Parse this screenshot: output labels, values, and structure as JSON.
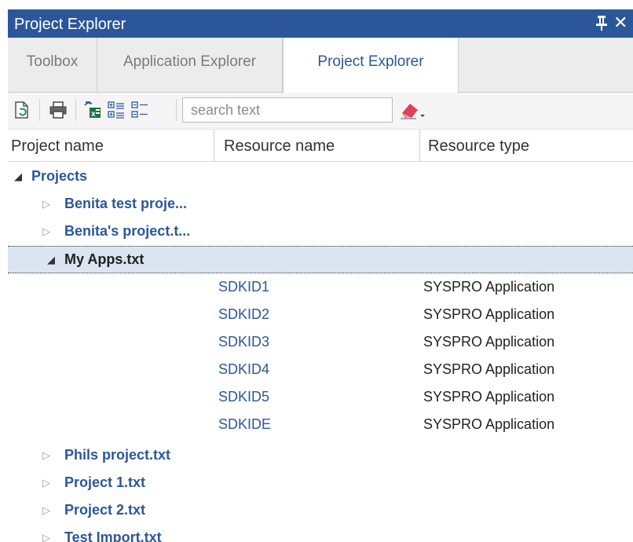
{
  "panel": {
    "title": "Project Explorer",
    "pin_icon": "pin-icon",
    "close_glyph": "✕"
  },
  "tabs": [
    {
      "label": "Toolbox",
      "active": false
    },
    {
      "label": "Application Explorer",
      "active": false
    },
    {
      "label": "Project Explorer",
      "active": true
    }
  ],
  "toolbar": {
    "icons": [
      "refresh-document-icon",
      "print-icon",
      "export-excel-icon",
      "expand-all-icon",
      "collapse-all-icon",
      "eraser-icon"
    ],
    "search_placeholder": "search text"
  },
  "columns": {
    "project_name": "Project name",
    "resource_name": "Resource name",
    "resource_type": "Resource type"
  },
  "tree": {
    "root": {
      "label": "Projects",
      "expanded": true
    },
    "items": [
      {
        "label": "Benita test proje...",
        "expanded": false
      },
      {
        "label": "Benita's project.t...",
        "expanded": false
      },
      {
        "label": "My Apps.txt",
        "expanded": true,
        "selected": true
      },
      {
        "label": "Phils project.txt",
        "expanded": false
      },
      {
        "label": "Project 1.txt",
        "expanded": false
      },
      {
        "label": "Project 2.txt",
        "expanded": false
      },
      {
        "label": "Test Import.txt",
        "expanded": false
      }
    ],
    "resources": [
      {
        "name": "SDKID1",
        "type": "SYSPRO Application"
      },
      {
        "name": "SDKID2",
        "type": "SYSPRO Application"
      },
      {
        "name": "SDKID3",
        "type": "SYSPRO Application"
      },
      {
        "name": "SDKID4",
        "type": "SYSPRO Application"
      },
      {
        "name": "SDKID5",
        "type": "SYSPRO Application"
      },
      {
        "name": "SDKIDE",
        "type": "SYSPRO Application"
      }
    ]
  },
  "colors": {
    "title_bar": "#2b579a",
    "link_text": "#2b579a",
    "selected_row": "#dbe4f1"
  }
}
